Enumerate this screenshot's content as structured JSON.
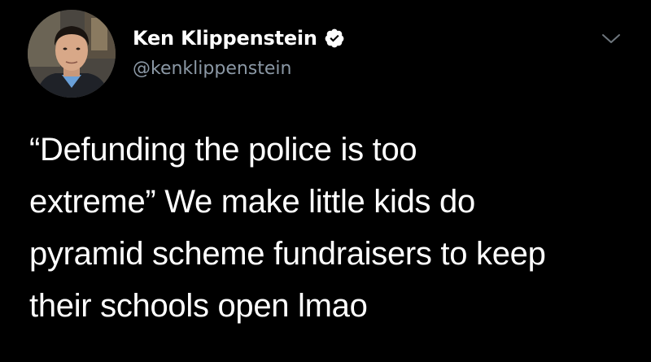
{
  "tweet": {
    "author": {
      "display_name": "Ken Klippenstein",
      "handle": "@kenklippenstein",
      "verified": true,
      "avatar_icon": "profile-photo"
    },
    "menu_icon": "chevron-down-icon",
    "text_lines": [
      "“Defunding the police is too",
      "extreme” We make little kids do",
      "pyramid scheme fundraisers to keep",
      "their schools open lmao"
    ]
  },
  "colors": {
    "background": "#000000",
    "text": "#ffffff",
    "handle": "#8b98a5",
    "verified_badge": "#ffffff"
  }
}
